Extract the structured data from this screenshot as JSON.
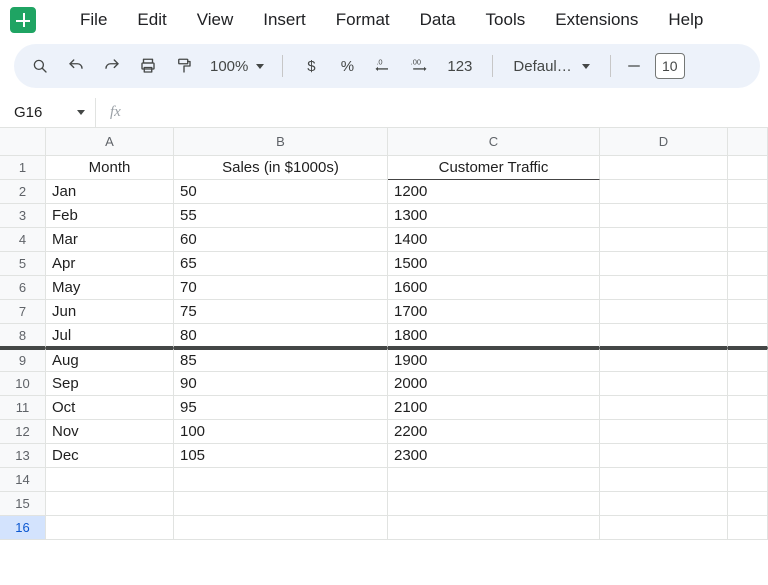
{
  "menus": [
    "File",
    "Edit",
    "View",
    "Insert",
    "Format",
    "Data",
    "Tools",
    "Extensions",
    "Help"
  ],
  "toolbar": {
    "zoom": "100%",
    "num_fmt": "123",
    "font": "Defaul…",
    "font_size": "10"
  },
  "namebox": "G16",
  "fx_label": "fx",
  "columns": [
    "A",
    "B",
    "C",
    "D",
    ""
  ],
  "rows": [
    "1",
    "2",
    "3",
    "4",
    "5",
    "6",
    "7",
    "8",
    "9",
    "10",
    "11",
    "12",
    "13",
    "14",
    "15",
    "16"
  ],
  "selected_row": 16,
  "headers": {
    "A": "Month",
    "B": "Sales (in $1000s)",
    "C": "Customer Traffic",
    "D": "",
    "E": ""
  },
  "data": [
    {
      "A": "Jan",
      "B": "50",
      "C": "1200",
      "D": "",
      "E": ""
    },
    {
      "A": "Feb",
      "B": "55",
      "C": "1300",
      "D": "",
      "E": ""
    },
    {
      "A": "Mar",
      "B": "60",
      "C": "1400",
      "D": "",
      "E": ""
    },
    {
      "A": "Apr",
      "B": "65",
      "C": "1500",
      "D": "",
      "E": ""
    },
    {
      "A": "May",
      "B": "70",
      "C": "1600",
      "D": "",
      "E": ""
    },
    {
      "A": "Jun",
      "B": "75",
      "C": "1700",
      "D": "",
      "E": ""
    },
    {
      "A": "Jul",
      "B": "80",
      "C": "1800",
      "D": "",
      "E": ""
    },
    {
      "A": "Aug",
      "B": "85",
      "C": "1900",
      "D": "",
      "E": ""
    },
    {
      "A": "Sep",
      "B": "90",
      "C": "2000",
      "D": "",
      "E": ""
    },
    {
      "A": "Oct",
      "B": "95",
      "C": "2100",
      "D": "",
      "E": ""
    },
    {
      "A": "Nov",
      "B": "100",
      "C": "2200",
      "D": "",
      "E": ""
    },
    {
      "A": "Dec",
      "B": "105",
      "C": "2300",
      "D": "",
      "E": ""
    },
    {
      "A": "",
      "B": "",
      "C": "",
      "D": "",
      "E": ""
    },
    {
      "A": "",
      "B": "",
      "C": "",
      "D": "",
      "E": ""
    },
    {
      "A": "",
      "B": "",
      "C": "",
      "D": "",
      "E": ""
    }
  ]
}
